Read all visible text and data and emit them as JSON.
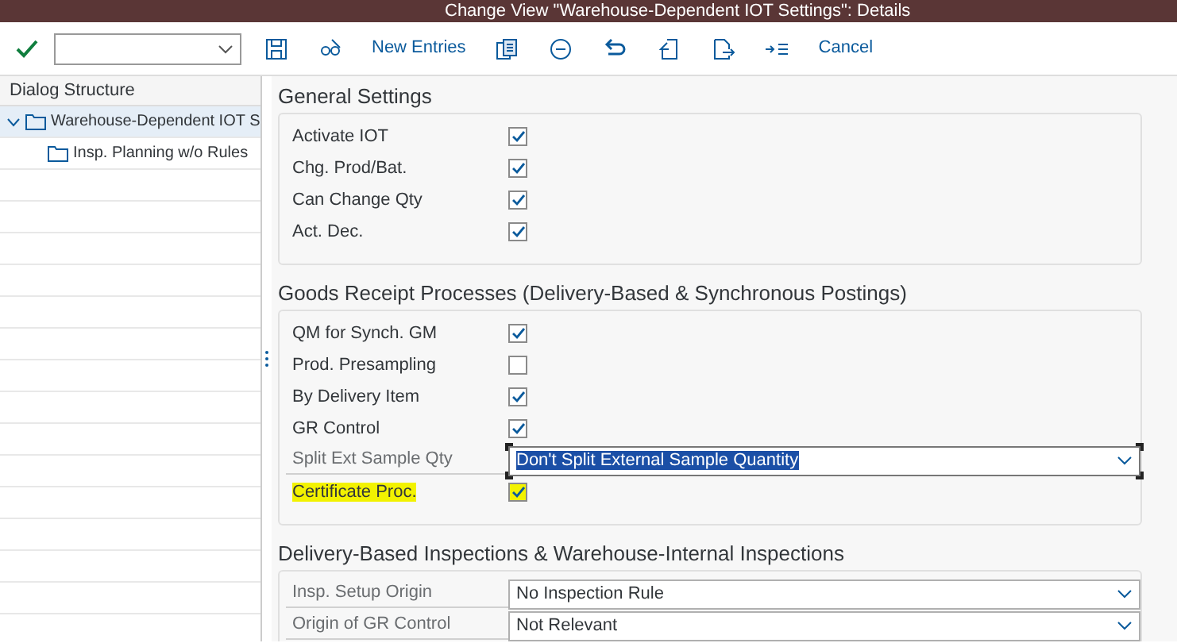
{
  "window": {
    "title": "Change View \"Warehouse-Dependent IOT Settings\": Details"
  },
  "toolbar": {
    "items": [
      {
        "kind": "text",
        "label": "New Entries"
      },
      {
        "kind": "text",
        "label": "Cancel"
      }
    ]
  },
  "dialog_structure": {
    "title": "Dialog Structure",
    "items": [
      {
        "label": "Warehouse-Dependent IOT S",
        "expanded": true,
        "selected": true,
        "children": [
          {
            "label": "Insp. Planning w/o Rules",
            "selected": false
          }
        ]
      }
    ]
  },
  "sections": [
    {
      "title": "General Settings",
      "rows": [
        {
          "kind": "checkbox",
          "label": "Activate IOT",
          "checked": true
        },
        {
          "kind": "checkbox",
          "label": "Chg. Prod/Bat.",
          "checked": true
        },
        {
          "kind": "checkbox",
          "label": "Can Change Qty",
          "checked": true
        },
        {
          "kind": "checkbox",
          "label": "Act. Dec.",
          "checked": true
        }
      ]
    },
    {
      "title": "Goods Receipt Processes (Delivery-Based & Synchronous Postings)",
      "rows": [
        {
          "kind": "checkbox",
          "label": "QM for Synch. GM",
          "checked": true
        },
        {
          "kind": "checkbox",
          "label": "Prod. Presampling",
          "checked": false
        },
        {
          "kind": "checkbox",
          "label": "By Delivery Item",
          "checked": true
        },
        {
          "kind": "checkbox",
          "label": "GR Control",
          "checked": true
        },
        {
          "kind": "dropdown",
          "label": "Split Ext Sample Qty",
          "value": "Don't Split External Sample Quantity",
          "focused": true
        },
        {
          "kind": "checkbox",
          "label": "Certificate Proc.",
          "checked": true,
          "highlighted": true
        }
      ]
    },
    {
      "title": "Delivery-Based Inspections & Warehouse-Internal Inspections",
      "rows": [
        {
          "kind": "dropdown",
          "label": "Insp. Setup Origin",
          "value": "No Inspection Rule",
          "focused": false
        },
        {
          "kind": "dropdown",
          "label": "Origin of GR Control",
          "value": "Not Relevant",
          "focused": false
        }
      ]
    }
  ]
}
